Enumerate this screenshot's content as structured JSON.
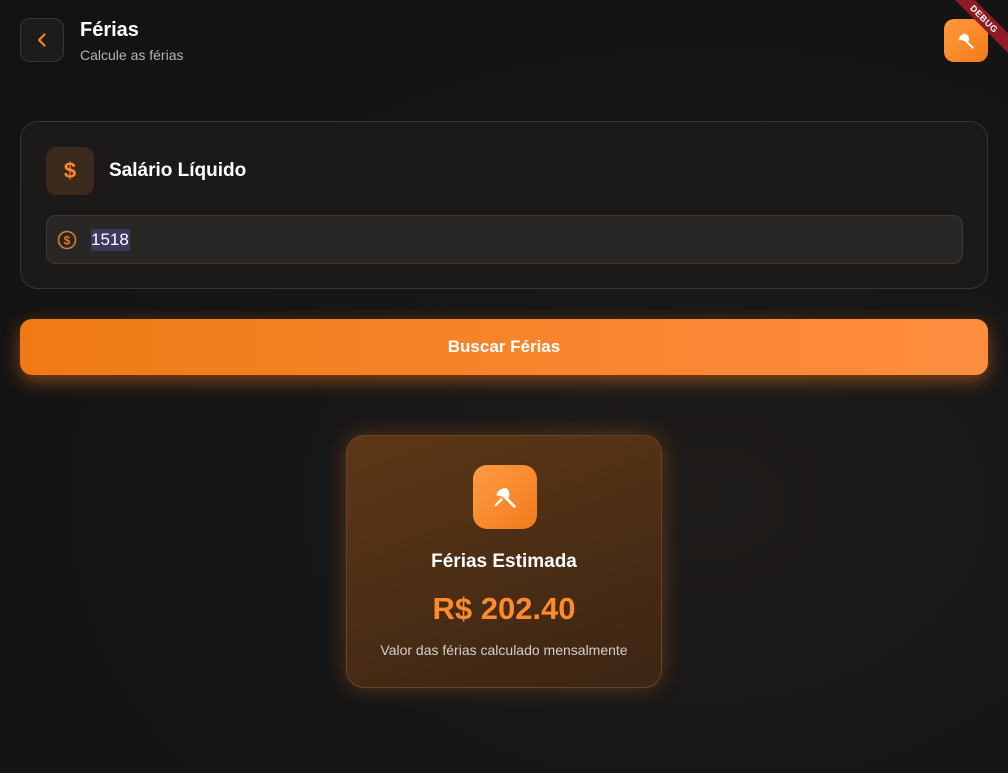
{
  "header": {
    "title": "Férias",
    "subtitle": "Calcule as férias",
    "debug_banner": "DEBUG"
  },
  "salary": {
    "label": "Salário Líquido",
    "currency_symbol": "$",
    "input_value": "1518"
  },
  "actions": {
    "search_label": "Buscar Férias"
  },
  "result": {
    "title": "Férias Estimada",
    "value": "R$ 202.40",
    "description": "Valor das férias calculado mensalmente"
  },
  "icons": {
    "back": "chevron-left-icon",
    "header_action": "beach-umbrella-icon",
    "salary": "dollar-icon",
    "input": "coin-icon",
    "result": "beach-umbrella-icon"
  },
  "colors": {
    "accent": "#f7821f",
    "background": "#141414",
    "card": "#1b1a19",
    "result_card": "#4a2d15",
    "debug_ribbon": "#8d1a24"
  }
}
